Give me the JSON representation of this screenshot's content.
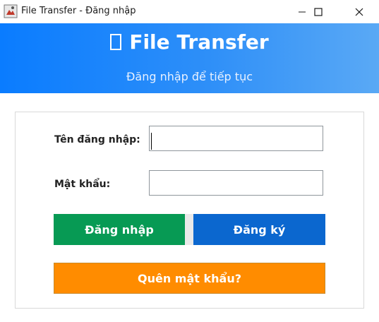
{
  "window": {
    "title": "File Transfer - Đăng nhập",
    "controls": [
      "minimize",
      "maximize",
      "close"
    ]
  },
  "header": {
    "title": "File Transfer",
    "subtitle": "Đăng nhập để tiếp tục",
    "icon": "missing-glyph-box",
    "gradient": [
      "#0a7cff",
      "#5aa9f5"
    ]
  },
  "form": {
    "username": {
      "label": "Tên đăng nhập:",
      "value": ""
    },
    "password": {
      "label": "Mật khẩu:",
      "value": ""
    }
  },
  "buttons": {
    "login": {
      "label": "Đăng nhập",
      "color": "#079a54"
    },
    "register": {
      "label": "Đăng ký",
      "color": "#0b67cf"
    },
    "forgot": {
      "label": "Quên mật khẩu?",
      "color": "#ff8c00"
    }
  }
}
